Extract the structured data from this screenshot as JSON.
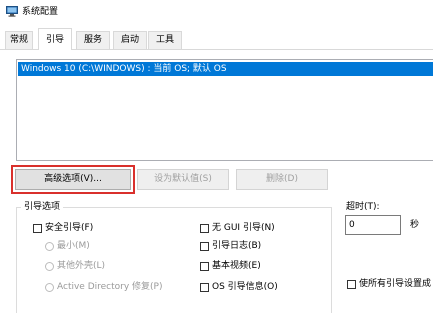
{
  "window": {
    "title": "系统配置"
  },
  "tabs": [
    {
      "label": "常规"
    },
    {
      "label": "引导"
    },
    {
      "label": "服务"
    },
    {
      "label": "启动"
    },
    {
      "label": "工具"
    }
  ],
  "active_tab": "引导",
  "os_list": {
    "items": [
      "Windows 10 (C:\\WINDOWS) : 当前 OS; 默认 OS"
    ]
  },
  "buttons": {
    "advanced": "高级选项(V)...",
    "set_default": "设为默认值(S)",
    "delete": "删除(D)"
  },
  "boot_options": {
    "title": "引导选项",
    "safe_boot": "安全引导(F)",
    "minimal": "最小(M)",
    "alternate_shell": "其他外壳(L)",
    "active_directory": "Active Directory 修复(P)",
    "no_gui": "无 GUI 引导(N)",
    "boot_log": "引导日志(B)",
    "base_video": "基本视频(E)",
    "os_boot_info": "OS 引导信息(O)"
  },
  "timeout": {
    "label": "超时(T):",
    "value": "0",
    "unit": "秒"
  },
  "make_permanent": "使所有引导设置成",
  "colors": {
    "selection": "#0078d7",
    "highlight_box": "#d9302c"
  }
}
